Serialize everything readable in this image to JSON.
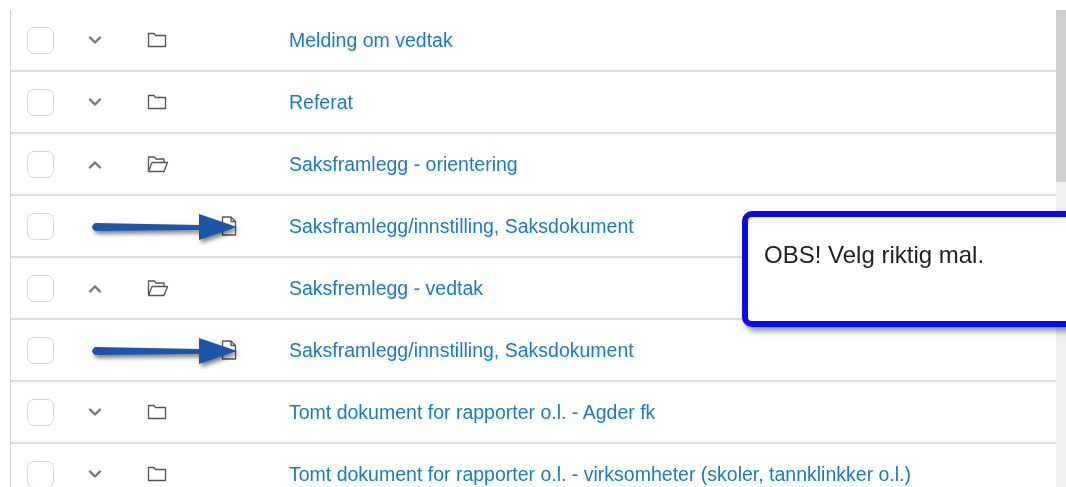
{
  "rows": [
    {
      "kind": "folder",
      "label": "Melding om vedtak",
      "checked": false,
      "expanded": false
    },
    {
      "kind": "folder",
      "label": "Referat",
      "checked": false,
      "expanded": false
    },
    {
      "kind": "folder",
      "label": "Saksframlegg - orientering",
      "checked": false,
      "expanded": true,
      "children": [
        {
          "kind": "document",
          "label": "Saksframlegg/innstilling, Saksdokument",
          "checked": false,
          "marked": true
        }
      ]
    },
    {
      "kind": "folder",
      "label": "Saksfremlegg - vedtak",
      "checked": false,
      "expanded": true,
      "children": [
        {
          "kind": "document",
          "label": "Saksframlegg/innstilling, Saksdokument",
          "checked": false,
          "marked": true
        }
      ]
    },
    {
      "kind": "folder",
      "label": "Tomt dokument for rapporter o.l. - Agder fk",
      "checked": false,
      "expanded": false
    },
    {
      "kind": "folder",
      "label": "Tomt dokument for rapporter o.l. - virksomheter (skoler, tannklinkker o.l.)",
      "checked": false,
      "expanded": false
    }
  ],
  "callout": {
    "text": "OBS! Velg riktig mal."
  }
}
